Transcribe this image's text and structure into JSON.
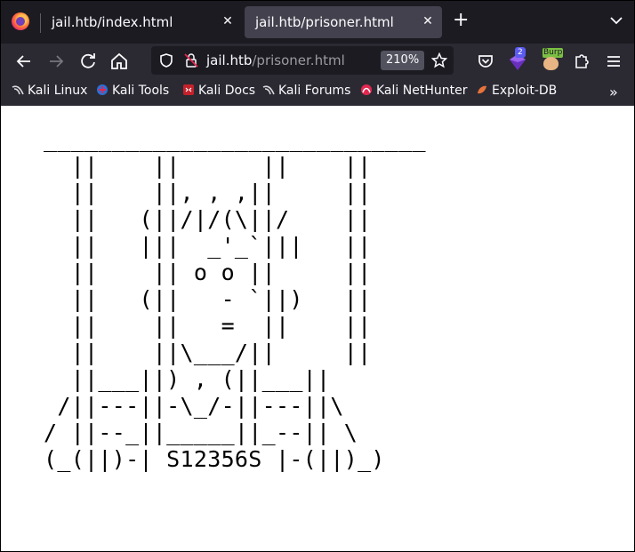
{
  "tabs": [
    {
      "label": "jail.htb/index.html",
      "active": false
    },
    {
      "label": "jail.htb/prisoner.html",
      "active": true
    }
  ],
  "toolbar": {
    "url_host": "jail.htb",
    "url_path": "/prisoner.html",
    "zoom": "210%",
    "extension_badge": "2",
    "burp_label": "Burp"
  },
  "bookmarks": [
    {
      "label": "Kali Linux",
      "icon": "kali-dragon-icon"
    },
    {
      "label": "Kali Tools",
      "icon": "kali-tools-icon"
    },
    {
      "label": "Kali Docs",
      "icon": "kali-docs-icon"
    },
    {
      "label": "Kali Forums",
      "icon": "kali-dragon-icon"
    },
    {
      "label": "Kali NetHunter",
      "icon": "nethunter-icon"
    },
    {
      "label": "Exploit-DB",
      "icon": "exploitdb-icon"
    }
  ],
  "page": {
    "ascii_art": "____________________________\n  ||    ||      ||    ||\n  ||    ||, , ,||     ||\n  ||   (||/|/(\\||/    ||\n  ||   |||  _'_`|||   ||\n  ||    || o o ||     ||\n  ||   (||   - `||)   ||\n  ||    ||   =  ||    ||\n  ||    ||\\___/||     ||\n  ||___||) , (||___||\n /||---||-\\_/-||---||\\\n/ ||--_||_____||_--|| \\\n(_(||)-| S12356S |-(||)_)"
  }
}
